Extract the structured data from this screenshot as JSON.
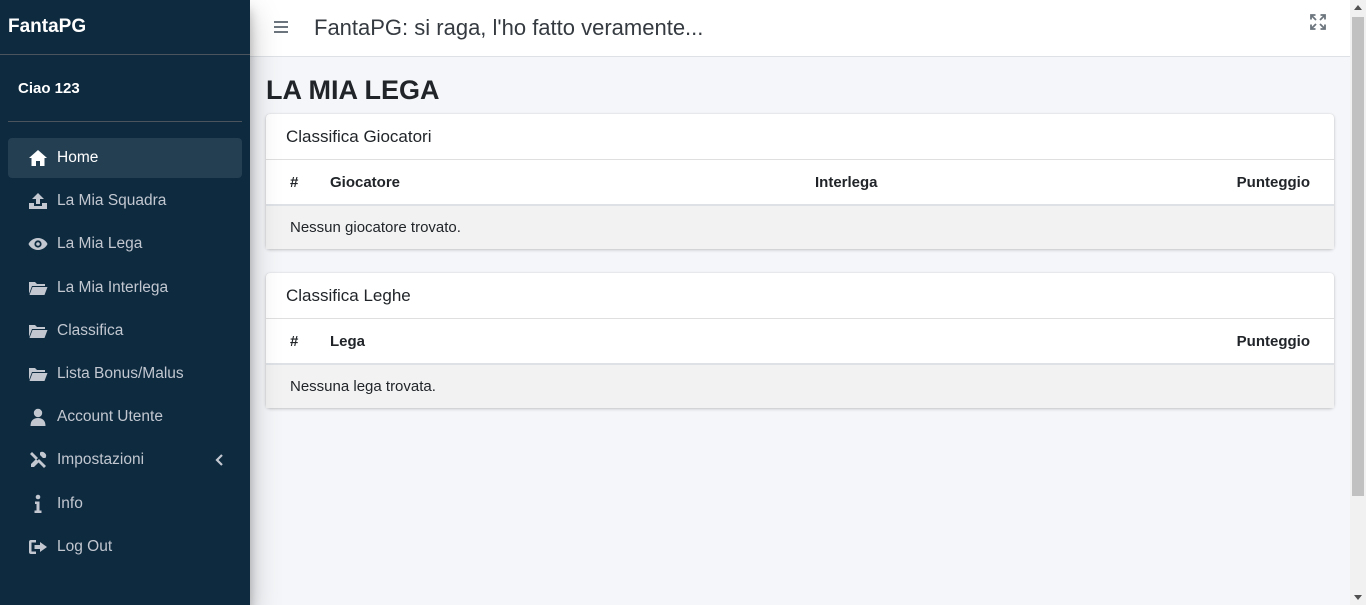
{
  "sidebar": {
    "brand": "FantaPG",
    "user_greeting": "Ciao 123",
    "items": [
      {
        "label": "Home",
        "icon": "home-icon",
        "active": true
      },
      {
        "label": "La Mia Squadra",
        "icon": "upload-icon"
      },
      {
        "label": "La Mia Lega",
        "icon": "eye-icon"
      },
      {
        "label": "La Mia Interlega",
        "icon": "folder-icon"
      },
      {
        "label": "Classifica",
        "icon": "folder-icon"
      },
      {
        "label": "Lista Bonus/Malus",
        "icon": "folder-icon"
      },
      {
        "label": "Account Utente",
        "icon": "user-icon"
      },
      {
        "label": "Impostazioni",
        "icon": "tools-icon",
        "has_submenu": true
      },
      {
        "label": "Info",
        "icon": "info-icon"
      },
      {
        "label": "Log Out",
        "icon": "sign-out-icon"
      }
    ]
  },
  "topbar": {
    "title": "FantaPG: si raga, l'ho fatto veramente..."
  },
  "main": {
    "page_title": "LA MIA LEGA",
    "players_card": {
      "title": "Classifica Giocatori",
      "columns": [
        "#",
        "Giocatore",
        "Interlega",
        "Punteggio"
      ],
      "empty_message": "Nessun giocatore trovato."
    },
    "leagues_card": {
      "title": "Classifica Leghe",
      "columns": [
        "#",
        "Lega",
        "Punteggio"
      ],
      "empty_message": "Nessuna lega trovata."
    }
  },
  "colors": {
    "sidebar_bg": "#0d2a3f",
    "page_bg": "#f4f6f9",
    "active_item_bg": "#ffffff1a"
  }
}
